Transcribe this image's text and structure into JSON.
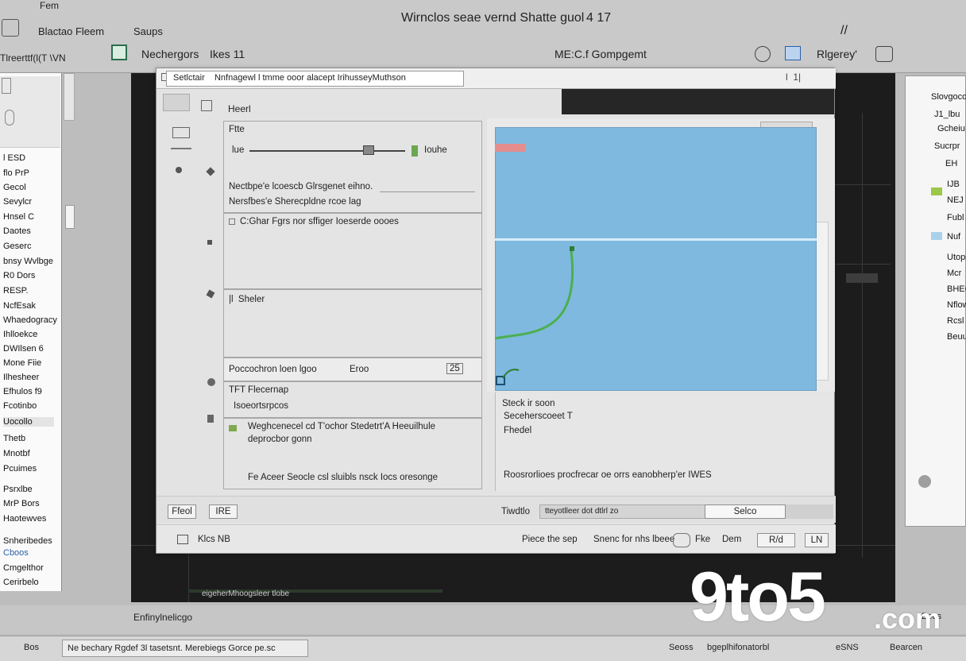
{
  "top": {
    "corner_label": "Fem",
    "window_title": "Wirnclos seae vernd Shatte guol",
    "version": "4 17",
    "menu_item_1": "Blactao Fleem",
    "menu_item_2": "Saups",
    "menu_item_3": "Tlreerttf(l(T \\VN",
    "menu_item_4": "Nechergors",
    "menu_item_5": "Ikes 11",
    "center_label": "ME:C.f Gompgemt",
    "right_label": "Rlgerey'",
    "right_corner": "//"
  },
  "left_panel": {
    "items": [
      "l ESD",
      "flo PrP",
      "Gecol",
      "Sevylcr",
      "Hnsel C",
      "Daotes",
      "Geserc",
      "bnsy Wvlbge",
      "R0 Dors",
      "RESP.",
      "NcfEsak",
      "Whaedogracy",
      "Ihlloekce",
      "DWIlsen 6",
      "Mone Fiie",
      "Ilhesheer",
      "Efhulos f9",
      "Fcotinbo",
      "Uocollo",
      "Thetb",
      "Mnotbf",
      "Pcuimes",
      "Psrxlbe",
      "MrP Bors",
      "Haotewves",
      "Snheribedes",
      "Cboos",
      "Cmgelthor",
      "Cerirbelo"
    ]
  },
  "right_panel": {
    "items": [
      "Slovgocoil",
      "J1_lbu",
      "Gcheiu",
      "Sucrpr",
      "EH",
      "IJB",
      "NEJ",
      "Fubl",
      "Nuf",
      "Utops",
      "Mcr",
      "BHEO",
      "Nflow",
      "Rcsl",
      "Beuufr"
    ]
  },
  "dialog": {
    "tab_label": "Setlctair    Nnfnagewl l tmme ooor alacept IrihusseyMuthson",
    "window_controls": "l  1|",
    "header": "Heerl",
    "section1": {
      "label": "Ftte",
      "slider_left": "lue",
      "slider_right": "Iouhe",
      "slider_value": 0.8,
      "line1": "Nectbpe'e lcoescb Glrsgenet eihno.",
      "line2": "Nersfbes'e Sherecpldne rcoe lag"
    },
    "section2": {
      "label": "C:Ghar Fgrs nor sffiger Ioeserde oooes"
    },
    "section3": {
      "label": "|l  Sheler"
    },
    "row_bar": {
      "left": "Poccochron loen lgoo",
      "mid": "Eroo",
      "right": "25"
    },
    "section4": {
      "line1": "TFT Flecernap",
      "line2": "Isoeortsrpcos"
    },
    "section5": {
      "line1": "Weghcenecel cd T'ochor Stedetrt'A Heeuilhule",
      "line2": "deprocbor gonn",
      "footer": "Fe Aceer Seocle csl sluibls nsck Iocs oresonge"
    },
    "info": {
      "line1": "Steck ir soon",
      "line2": "Seceherscoeet T",
      "line3": "Fhedel",
      "footer": "Roosrorlioes procfrecar oe orrs eanobherp'er IWES"
    },
    "footer": {
      "btn1": "Ffeol",
      "btn2": "IRE",
      "field_label": "Tiwdtlo",
      "field_value": "tteyotlleer dot dtlrl zo",
      "field_btn": "Selco",
      "left_label": "Klcs NB",
      "label_a": "Piece the sep",
      "label_b": "Snenc for nhs lbeee",
      "toggle": "Fke",
      "label_c": "Dem",
      "label_d": "R/d",
      "btn3": "LN"
    }
  },
  "bottom": {
    "bar1_left": "Enfinylnelicgo",
    "bar1_mid": "eigeherMhoogsleer tlobe",
    "bar1_right": "Bees",
    "status_1": "Bos",
    "status_2": "Ne bechary  Rgdef 3l tasetsnt. Merebiegs Gorce pe.sc",
    "status_3": "Seoss",
    "status_4": "bgeplhifonatorbl",
    "status_5": "eSNS",
    "status_6": "Bearcen"
  },
  "watermark": {
    "main": "9to5",
    "suffix": ".com"
  },
  "colors": {
    "preview": "#7fb9df",
    "workspace": "#1c1c1c",
    "curve": "#4caf50",
    "accent_red": "#e58d8d"
  }
}
